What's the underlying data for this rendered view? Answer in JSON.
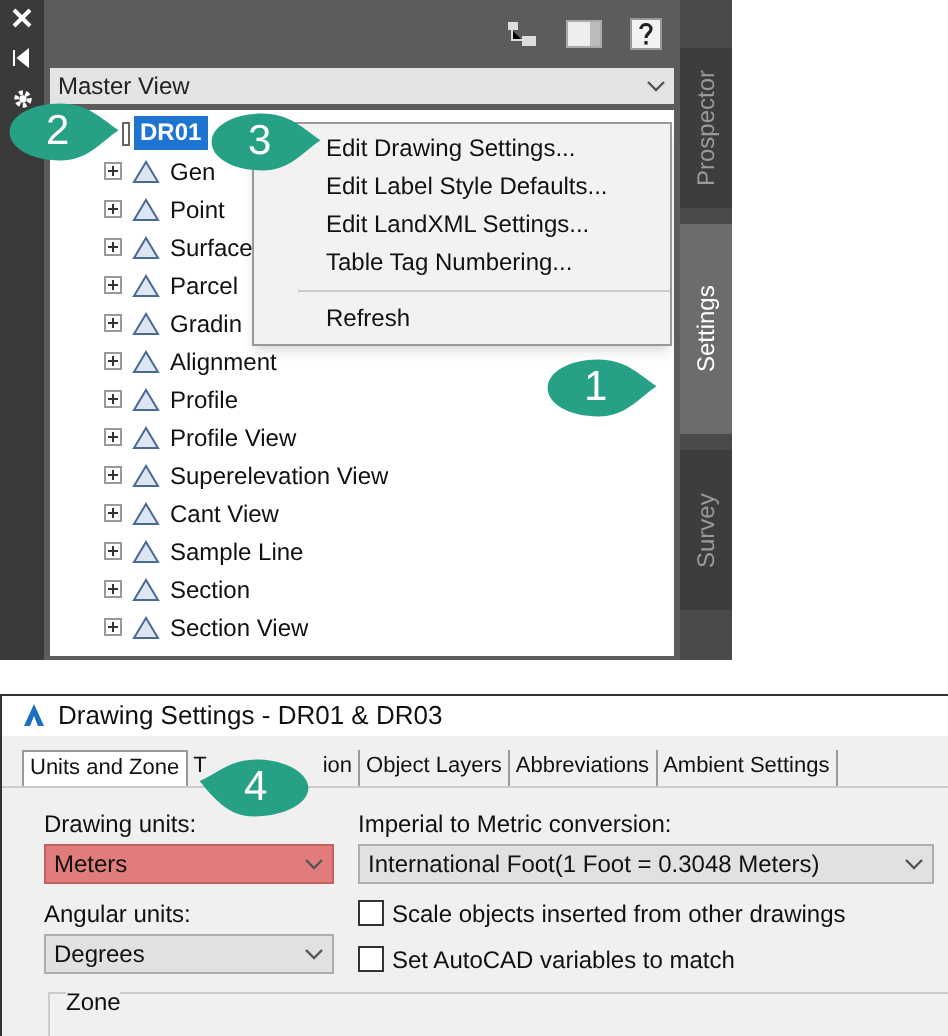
{
  "palette": {
    "dropdown": {
      "value": "Master View"
    },
    "tree": {
      "root": {
        "label": "DR01",
        "selected": true
      },
      "children": [
        {
          "label": "Gen",
          "expanded": false
        },
        {
          "label": "Point",
          "expanded": false
        },
        {
          "label": "Surface",
          "expanded": false
        },
        {
          "label": "Parcel",
          "expanded": false
        },
        {
          "label": "Gradin",
          "expanded": false
        },
        {
          "label": "Alignment",
          "expanded": false
        },
        {
          "label": "Profile",
          "expanded": false
        },
        {
          "label": "Profile View",
          "expanded": false
        },
        {
          "label": "Superelevation View",
          "expanded": false
        },
        {
          "label": "Cant View",
          "expanded": false
        },
        {
          "label": "Sample Line",
          "expanded": false
        },
        {
          "label": "Section",
          "expanded": false
        },
        {
          "label": "Section View",
          "expanded": false
        }
      ]
    },
    "context_menu": [
      {
        "label": "Edit Drawing Settings...",
        "kind": "item"
      },
      {
        "label": "Edit Label Style Defaults...",
        "kind": "item"
      },
      {
        "label": "Edit LandXML Settings...",
        "kind": "item"
      },
      {
        "label": "Table Tag Numbering...",
        "kind": "item"
      },
      {
        "kind": "separator"
      },
      {
        "label": "Refresh",
        "kind": "item"
      }
    ],
    "side_tabs": [
      {
        "label": "Prospector",
        "selected": false
      },
      {
        "label": "Settings",
        "selected": true
      },
      {
        "label": "Survey",
        "selected": false
      }
    ]
  },
  "dialog": {
    "title": "Drawing Settings - DR01 & DR03",
    "tabs": [
      {
        "label": "Units and Zone",
        "selected": true
      },
      {
        "label_start": "T",
        "label_end": "ion",
        "selected": false
      },
      {
        "label": "Object Layers",
        "selected": false
      },
      {
        "label": "Abbreviations",
        "selected": false
      },
      {
        "label": "Ambient Settings",
        "selected": false
      }
    ],
    "drawing_units": {
      "label": "Drawing units:",
      "value": "Meters",
      "highlighted": true
    },
    "angular_units": {
      "label": "Angular units:",
      "value": "Degrees",
      "highlighted": false
    },
    "conversion": {
      "label": "Imperial to Metric conversion:",
      "value": "International Foot(1 Foot = 0.3048 Meters)"
    },
    "checkboxes": [
      {
        "label": "Scale objects inserted from other drawings",
        "checked": false
      },
      {
        "label": "Set AutoCAD variables to match",
        "checked": false
      }
    ],
    "zone_group": {
      "label": "Zone"
    }
  },
  "callouts": [
    {
      "number": "1"
    },
    {
      "number": "2"
    },
    {
      "number": "3"
    },
    {
      "number": "4"
    }
  ]
}
